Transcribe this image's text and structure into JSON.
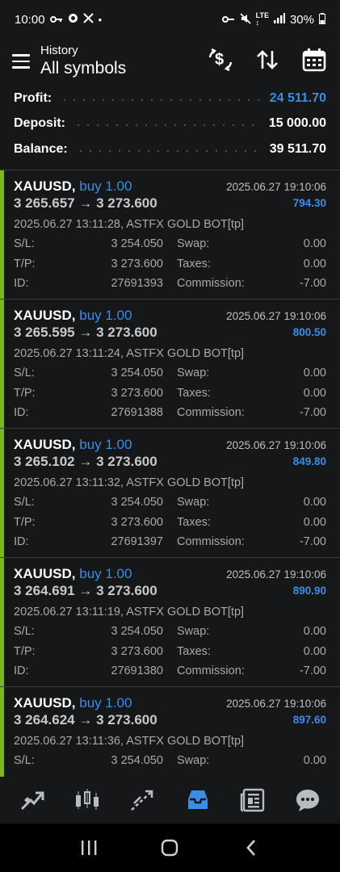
{
  "status_bar": {
    "time": "10:00",
    "battery": "30%",
    "left_icons": [
      "key-icon",
      "sync-icon",
      "x-logo-icon",
      "dot-icon"
    ],
    "right_icons": [
      "key-icon",
      "mute-icon",
      "lte-icon",
      "signal-icon",
      "battery-icon"
    ]
  },
  "header": {
    "subtitle": "History",
    "title": "All symbols",
    "actions": [
      "currency-exchange-icon",
      "sort-arrows-icon",
      "calendar-icon"
    ]
  },
  "summary": {
    "profit_label": "Profit:",
    "profit_value": "24 511.70",
    "deposit_label": "Deposit:",
    "deposit_value": "15 000.00",
    "balance_label": "Balance:",
    "balance_value": "39 511.70"
  },
  "labels": {
    "sl": "S/L:",
    "tp": "T/P:",
    "id": "ID:",
    "swap": "Swap:",
    "taxes": "Taxes:",
    "commission": "Commission:"
  },
  "deals": [
    {
      "symbol": "XAUUSD,",
      "side": "buy 1.00",
      "prices": "3 265.657 → 3 273.600",
      "close_time": "2025.06.27 19:10:06",
      "profit": "794.30",
      "comment": "2025.06.27 13:11:28, ASTFX GOLD BOT[tp]",
      "sl": "3 254.050",
      "tp": "3 273.600",
      "id": "27691393",
      "swap": "0.00",
      "taxes": "0.00",
      "commission": "-7.00"
    },
    {
      "symbol": "XAUUSD,",
      "side": "buy 1.00",
      "prices": "3 265.595 → 3 273.600",
      "close_time": "2025.06.27 19:10:06",
      "profit": "800.50",
      "comment": "2025.06.27 13:11:24, ASTFX GOLD BOT[tp]",
      "sl": "3 254.050",
      "tp": "3 273.600",
      "id": "27691388",
      "swap": "0.00",
      "taxes": "0.00",
      "commission": "-7.00"
    },
    {
      "symbol": "XAUUSD,",
      "side": "buy 1.00",
      "prices": "3 265.102 → 3 273.600",
      "close_time": "2025.06.27 19:10:06",
      "profit": "849.80",
      "comment": "2025.06.27 13:11:32, ASTFX GOLD BOT[tp]",
      "sl": "3 254.050",
      "tp": "3 273.600",
      "id": "27691397",
      "swap": "0.00",
      "taxes": "0.00",
      "commission": "-7.00"
    },
    {
      "symbol": "XAUUSD,",
      "side": "buy 1.00",
      "prices": "3 264.691 → 3 273.600",
      "close_time": "2025.06.27 19:10:06",
      "profit": "890.90",
      "comment": "2025.06.27 13:11:19, ASTFX GOLD BOT[tp]",
      "sl": "3 254.050",
      "tp": "3 273.600",
      "id": "27691380",
      "swap": "0.00",
      "taxes": "0.00",
      "commission": "-7.00"
    },
    {
      "symbol": "XAUUSD,",
      "side": "buy 1.00",
      "prices": "3 264.624 → 3 273.600",
      "close_time": "2025.06.27 19:10:06",
      "profit": "897.60",
      "comment": "2025.06.27 13:11:36, ASTFX GOLD BOT[tp]",
      "sl": "3 254.050",
      "tp": "",
      "id": "",
      "swap": "0.00",
      "taxes": "",
      "commission": ""
    }
  ],
  "bottom_nav": {
    "items": [
      "quotes-icon",
      "chart-icon",
      "trade-icon",
      "history-icon",
      "news-icon",
      "messages-icon"
    ],
    "active": "history-icon",
    "active_color": "#3b8de6"
  },
  "colors": {
    "accent_blue": "#3b8de6",
    "buy_bar_green": "#7fb51f",
    "background": "#151719"
  }
}
